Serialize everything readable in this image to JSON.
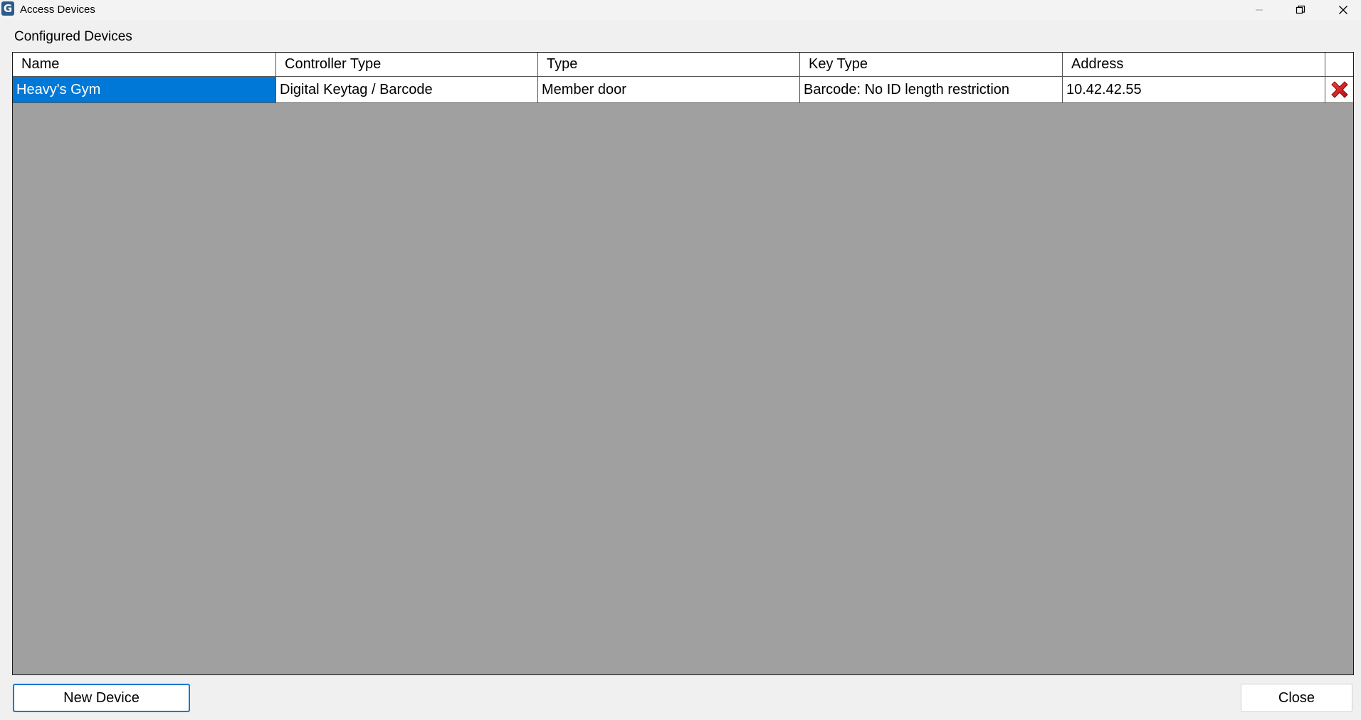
{
  "window": {
    "title": "Access Devices",
    "icon_glyph": "G"
  },
  "section": {
    "label": "Configured Devices"
  },
  "table": {
    "columns": [
      "Name",
      "Controller Type",
      "Type",
      "Key Type",
      "Address"
    ],
    "rows": [
      {
        "name": "Heavy's Gym",
        "controller_type": "Digital Keytag / Barcode",
        "type": "Member door",
        "key_type": "Barcode: No ID length restriction",
        "address": "10.42.42.55",
        "selected": true
      }
    ]
  },
  "buttons": {
    "new_device": "New Device",
    "close": "Close"
  },
  "colors": {
    "selection": "#0078d7",
    "delete": "#d42020",
    "grid_background": "#a0a0a0"
  },
  "icons": {
    "app": "app-logo-icon",
    "minimize": "minimize-icon",
    "restore": "restore-icon",
    "close": "close-icon",
    "delete": "delete-x-icon"
  }
}
